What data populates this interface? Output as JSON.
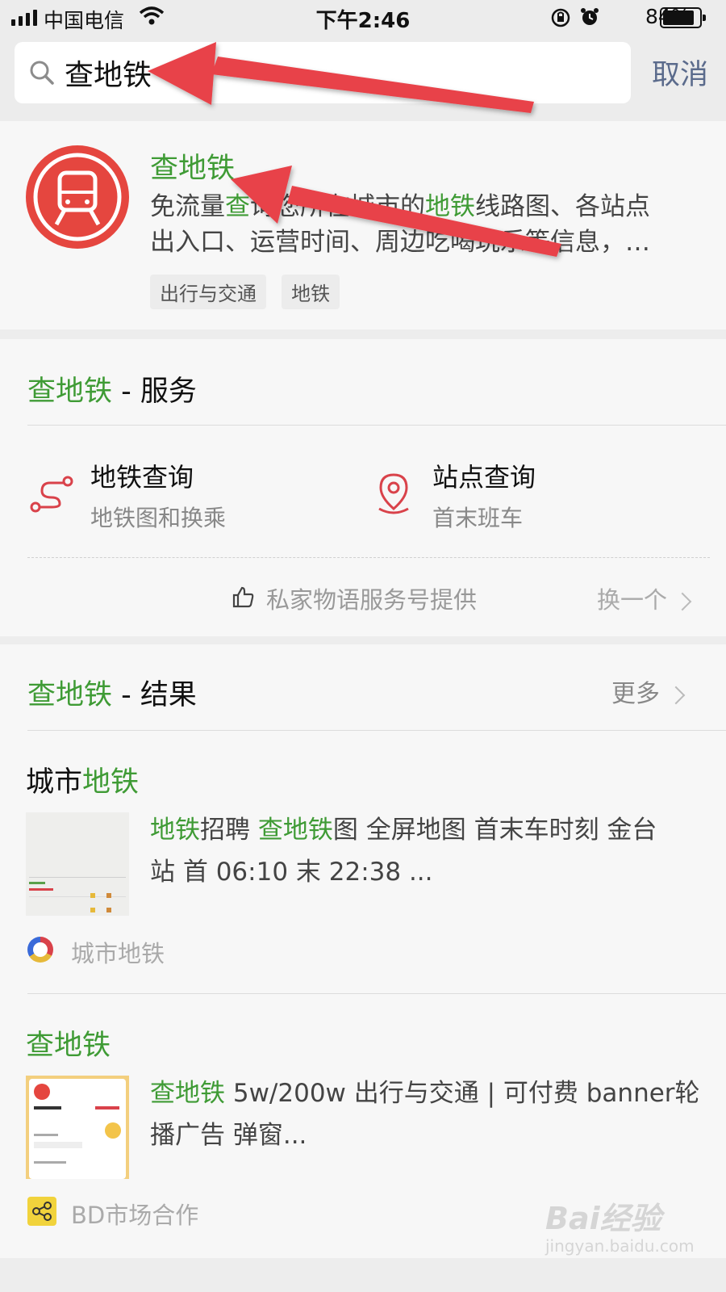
{
  "status_bar": {
    "carrier": "中国电信",
    "time": "下午2:46",
    "battery": "84%"
  },
  "search": {
    "query": "查地铁",
    "cancel_label": "取消"
  },
  "top_result": {
    "title": "查地铁",
    "desc_1_pre": "免流量",
    "desc_1_hl": "查",
    "desc_1_mid": "询您所在城市的",
    "desc_1_hl2": "地铁",
    "desc_1_post": "线路图、各站点",
    "desc_2": "出入口、运营时间、周边吃喝玩乐等信息，…",
    "tags": [
      "出行与交通",
      "地铁"
    ]
  },
  "services": {
    "heading_hl": "查地铁",
    "heading_rest": " - 服务",
    "items": [
      {
        "title": "地铁查询",
        "subtitle": "地铁图和换乘",
        "icon": "route-icon"
      },
      {
        "title": "站点查询",
        "subtitle": "首末班车",
        "icon": "location-pin-icon"
      }
    ],
    "provider": "私家物语服务号提供",
    "switch_label": "换一个"
  },
  "results": {
    "heading_hl": "查地铁",
    "heading_rest": " - 结果",
    "more_label": "更多",
    "items": [
      {
        "title_pre": "城市",
        "title_hl": "地铁",
        "snippet_hl1": "地铁",
        "snippet_a": "招聘 ",
        "snippet_hl2": "查地铁",
        "snippet_b": "图 全屏地图 首末车时刻 金台",
        "snippet_c": "站 首 06:10 末 22:38 ...",
        "source": "城市地铁"
      },
      {
        "title_hl": "查地铁",
        "snippet_hl1": "查地铁",
        "snippet_a": " 5w/200w 出行与交通 | 可付费 banner轮",
        "snippet_c": "播广告 弹窗...",
        "source": "BD市场合作"
      }
    ]
  },
  "watermark": {
    "brand": "Bai经验",
    "url": "jingyan.baidu.com"
  },
  "colors": {
    "accent_green": "#3f9b35",
    "annotation_red": "#e8424a",
    "cancel_blue": "#5b6b8c"
  }
}
